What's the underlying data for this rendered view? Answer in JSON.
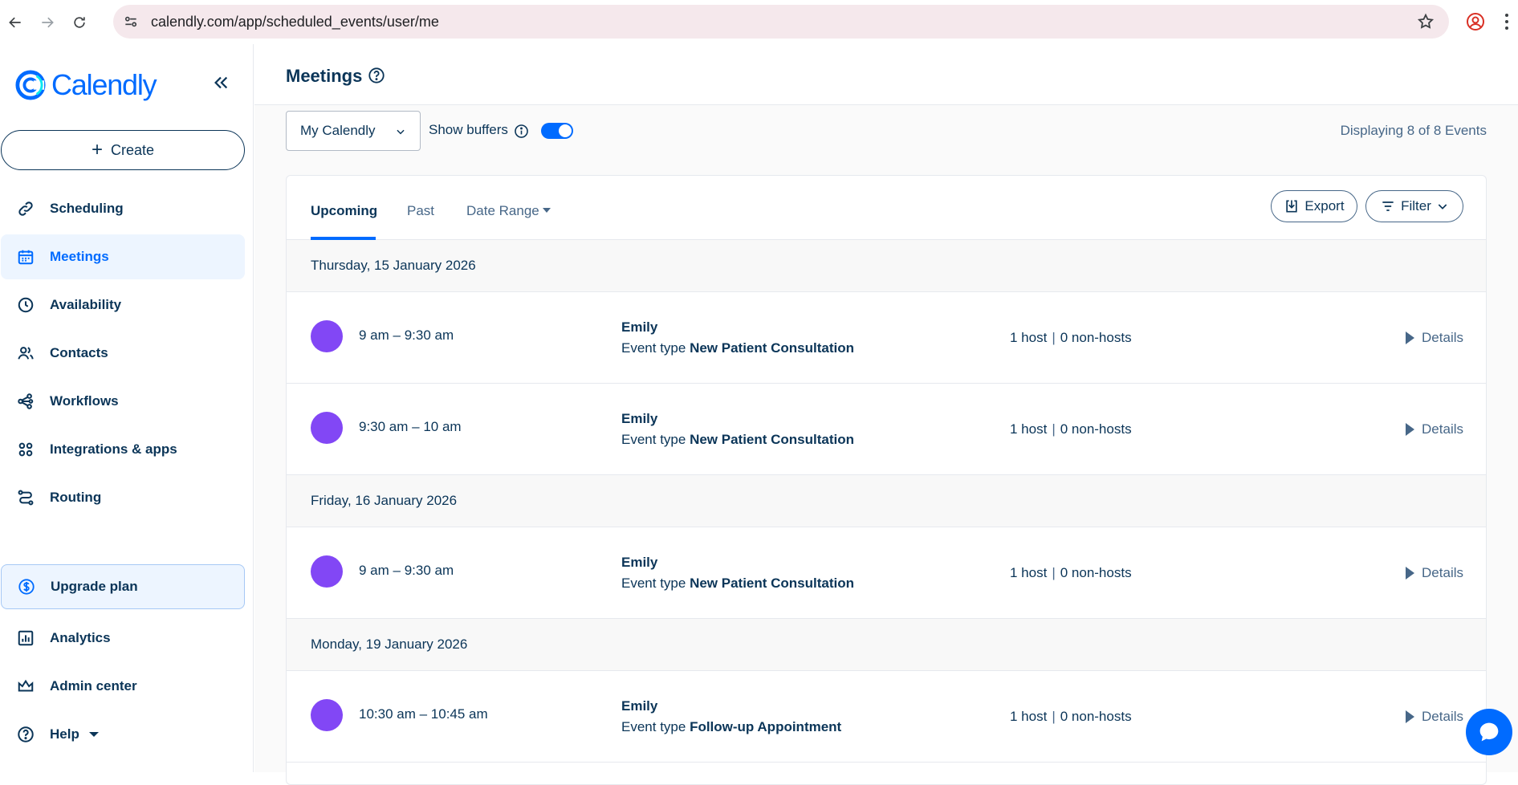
{
  "browser": {
    "url": "calendly.com/app/scheduled_events/user/me"
  },
  "sidebar": {
    "brand": "Calendly",
    "create_label": "Create",
    "items": [
      {
        "label": "Scheduling",
        "icon": "link-icon"
      },
      {
        "label": "Meetings",
        "icon": "calendar-icon",
        "active": true
      },
      {
        "label": "Availability",
        "icon": "clock-icon"
      },
      {
        "label": "Contacts",
        "icon": "users-icon"
      },
      {
        "label": "Workflows",
        "icon": "workflow-icon"
      },
      {
        "label": "Integrations & apps",
        "icon": "apps-grid-icon"
      },
      {
        "label": "Routing",
        "icon": "routing-icon"
      }
    ],
    "upgrade_label": "Upgrade plan",
    "bottom_items": [
      {
        "label": "Analytics",
        "icon": "analytics-icon"
      },
      {
        "label": "Admin center",
        "icon": "crown-icon"
      },
      {
        "label": "Help",
        "icon": "help-icon"
      }
    ]
  },
  "header": {
    "title": "Meetings"
  },
  "toolbar": {
    "calendar_select": "My Calendly",
    "show_buffers_label": "Show buffers",
    "show_buffers_on": true,
    "display_count": "Displaying 8 of 8 Events"
  },
  "tabs": {
    "upcoming": "Upcoming",
    "past": "Past",
    "date_range": "Date Range",
    "export": "Export",
    "filter": "Filter"
  },
  "days": [
    {
      "date": "Thursday, 15 January 2026",
      "events": [
        {
          "time": "9 am – 9:30 am",
          "name": "Emily",
          "type_prefix": "Event type",
          "type": "New Patient Consultation",
          "hosts": "1 host",
          "non_hosts": "0 non-hosts",
          "details": "Details"
        },
        {
          "time": "9:30 am – 10 am",
          "name": "Emily",
          "type_prefix": "Event type",
          "type": "New Patient Consultation",
          "hosts": "1 host",
          "non_hosts": "0 non-hosts",
          "details": "Details"
        }
      ]
    },
    {
      "date": "Friday, 16 January 2026",
      "events": [
        {
          "time": "9 am – 9:30 am",
          "name": "Emily",
          "type_prefix": "Event type",
          "type": "New Patient Consultation",
          "hosts": "1 host",
          "non_hosts": "0 non-hosts",
          "details": "Details"
        }
      ]
    },
    {
      "date": "Monday, 19 January 2026",
      "events": [
        {
          "time": "10:30 am – 10:45 am",
          "name": "Emily",
          "type_prefix": "Event type",
          "type": "Follow-up Appointment",
          "hosts": "1 host",
          "non_hosts": "0 non-hosts",
          "details": "Details"
        }
      ]
    }
  ],
  "colors": {
    "accent": "#006bff",
    "text": "#0b3558",
    "event_dot": "#8247f5"
  }
}
